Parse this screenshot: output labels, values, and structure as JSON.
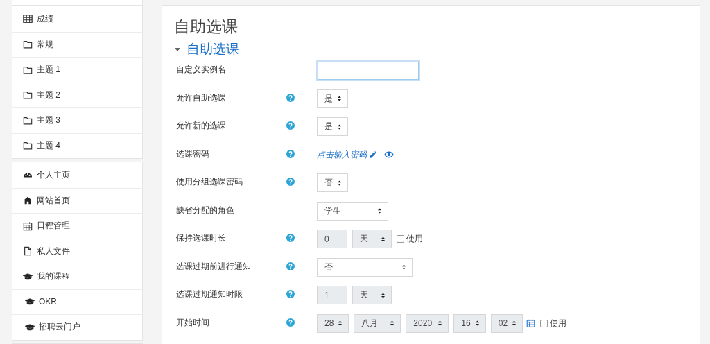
{
  "sidebar": {
    "groups": [
      {
        "items": [
          {
            "kind": "grades",
            "label": "成绩"
          },
          {
            "kind": "section",
            "label": "常规"
          },
          {
            "kind": "section",
            "label": "主题 1"
          },
          {
            "kind": "section",
            "label": "主题 2"
          },
          {
            "kind": "section",
            "label": "主题 3"
          },
          {
            "kind": "section",
            "label": "主题 4"
          }
        ]
      },
      {
        "items": [
          {
            "kind": "dashboard",
            "label": "个人主页"
          },
          {
            "kind": "home",
            "label": "网站首页"
          },
          {
            "kind": "calendar",
            "label": "日程管理"
          },
          {
            "kind": "files",
            "label": "私人文件"
          },
          {
            "kind": "courses",
            "label": "我的课程"
          },
          {
            "kind": "course",
            "label": "OKR"
          },
          {
            "kind": "course",
            "label": "招聘云门户"
          }
        ]
      }
    ]
  },
  "page_title": "自助选课",
  "section": {
    "title": "自助选课",
    "expanded": true,
    "fields": [
      {
        "label": "自定义实例名",
        "help": false,
        "controls": [
          {
            "kind": "input"
          }
        ]
      },
      {
        "label": "允许自助选课",
        "help": true,
        "controls": [
          {
            "kind": "select",
            "value": "是",
            "disabled": false
          }
        ]
      },
      {
        "label": "允许新的选课",
        "help": true,
        "controls": [
          {
            "kind": "select",
            "value": "是",
            "disabled": false
          }
        ]
      },
      {
        "label": "选课密码",
        "help": true,
        "controls": [
          {
            "kind": "link",
            "value": "点击输入密码"
          },
          {
            "kind": "eye"
          }
        ]
      },
      {
        "label": "使用分组选课密码",
        "help": true,
        "controls": [
          {
            "kind": "select",
            "value": "否",
            "disabled": false
          }
        ]
      },
      {
        "label": "缺省分配的角色",
        "help": false,
        "controls": [
          {
            "kind": "select",
            "value": "学生",
            "disabled": false
          }
        ]
      },
      {
        "label": "保持选课时长",
        "help": true,
        "controls": [
          {
            "kind": "number",
            "value": "0",
            "disabled": true
          },
          {
            "kind": "select",
            "value": "天",
            "disabled": true
          },
          {
            "kind": "checkbox",
            "label": "使用",
            "checked": false
          }
        ]
      },
      {
        "label": "选课过期前进行通知",
        "help": true,
        "controls": [
          {
            "kind": "select",
            "value": "否",
            "disabled": false
          }
        ]
      },
      {
        "label": "选课过期通知时限",
        "help": true,
        "controls": [
          {
            "kind": "number",
            "value": "1",
            "disabled": true
          },
          {
            "kind": "select",
            "value": "天",
            "disabled": true
          }
        ]
      },
      {
        "label": "开始时间",
        "help": true,
        "controls": [
          {
            "kind": "select",
            "value": "28",
            "disabled": true
          },
          {
            "kind": "select",
            "value": "八月",
            "disabled": true
          },
          {
            "kind": "select",
            "value": "2020",
            "disabled": true
          },
          {
            "kind": "select",
            "value": "16",
            "disabled": true
          },
          {
            "kind": "select",
            "value": "02",
            "disabled": true
          },
          {
            "kind": "calendar"
          },
          {
            "kind": "checkbox",
            "label": "使用",
            "checked": false
          }
        ]
      }
    ]
  }
}
